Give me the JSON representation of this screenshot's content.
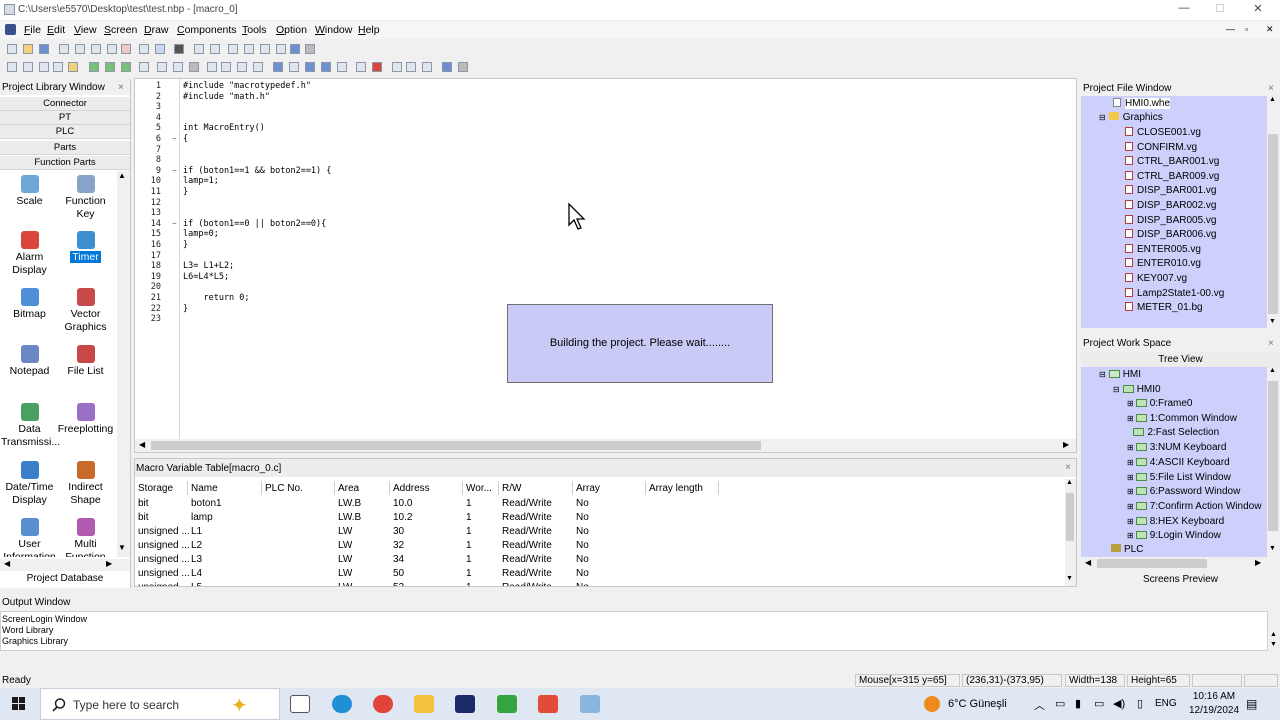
{
  "window": {
    "title": "C:\\Users\\e5570\\Desktop\\test\\test.nbp - [macro_0]",
    "minimize": "—",
    "maximize": "☐",
    "close": "✕"
  },
  "menu": [
    "File",
    "Edit",
    "View",
    "Screen",
    "Draw",
    "Components",
    "Tools",
    "Option",
    "Window",
    "Help"
  ],
  "library": {
    "title": "Project Library Window",
    "categories": [
      "Connector",
      "PT",
      "PLC",
      "Parts",
      "Function Parts"
    ],
    "items": [
      {
        "label": "Scale",
        "icon": "scale-icon",
        "color": "#6fa8d8"
      },
      {
        "label": "Function Key",
        "icon": "function-key-icon",
        "color": "#8aa3c8"
      },
      {
        "label": "Alarm Display",
        "icon": "alarm-display-icon",
        "color": "#d9473c"
      },
      {
        "label": "Timer",
        "icon": "timer-icon",
        "color": "#3f8fd0"
      },
      {
        "label": "Bitmap",
        "icon": "bitmap-icon",
        "color": "#4f8fd8"
      },
      {
        "label": "Vector Graphics",
        "icon": "vector-graphics-icon",
        "color": "#c84a4a"
      },
      {
        "label": "Notepad",
        "icon": "notepad-icon",
        "color": "#6b88c4"
      },
      {
        "label": "File List",
        "icon": "file-list-icon",
        "color": "#c84848"
      },
      {
        "label": "Data Transmissi...",
        "icon": "data-transmission-icon",
        "color": "#4aa060"
      },
      {
        "label": "Freeplotting",
        "icon": "freeplotting-icon",
        "color": "#9a6fc8"
      },
      {
        "label": "Date/Time Display",
        "icon": "date-time-icon",
        "color": "#3a7fc8"
      },
      {
        "label": "Indirect Shape",
        "icon": "indirect-shape-icon",
        "color": "#c86a2a"
      },
      {
        "label": "User Information",
        "icon": "user-icon",
        "color": "#5a8fcf"
      },
      {
        "label": "Multi Function",
        "icon": "multi-function-icon",
        "color": "#b05ab0"
      }
    ],
    "footer": "Project Database"
  },
  "editor": {
    "lines": [
      "#include \"macrotypedef.h\"",
      "#include \"math.h\"",
      "",
      "",
      "int MacroEntry()",
      "{",
      "",
      "",
      "if (boton1==1 && boton2==1) {",
      "lamp=1;",
      "}",
      "",
      "",
      "if (boton1==0 || boton2==0){",
      "lamp=0;",
      "}",
      "",
      "L3= L1+L2;",
      "L6=L4*L5;",
      "",
      "    return 0;",
      "}",
      ""
    ]
  },
  "dialog": {
    "message": "Building the project. Please wait........"
  },
  "macro_table": {
    "title": "Macro Variable Table[macro_0.c]",
    "columns": [
      "Storage ...",
      "Name",
      "PLC No.",
      "Area",
      "Address",
      "Wor...",
      "R/W",
      "Array",
      "Array length"
    ],
    "rows": [
      [
        "bit",
        "boton1",
        "",
        "LW.B",
        "10.0",
        "1",
        "Read/Write",
        "No",
        ""
      ],
      [
        "bit",
        "lamp",
        "",
        "LW.B",
        "10.2",
        "1",
        "Read/Write",
        "No",
        ""
      ],
      [
        "unsigned ...",
        "L1",
        "",
        "LW",
        "30",
        "1",
        "Read/Write",
        "No",
        ""
      ],
      [
        "unsigned ...",
        "L2",
        "",
        "LW",
        "32",
        "1",
        "Read/Write",
        "No",
        ""
      ],
      [
        "unsigned ...",
        "L3",
        "",
        "LW",
        "34",
        "1",
        "Read/Write",
        "No",
        ""
      ],
      [
        "unsigned ...",
        "L4",
        "",
        "LW",
        "50",
        "1",
        "Read/Write",
        "No",
        ""
      ],
      [
        "unsigned ...",
        "L5",
        "",
        "LW",
        "52",
        "1",
        "Read/Write",
        "No",
        ""
      ]
    ]
  },
  "project_files": {
    "title": "Project File Window",
    "root": "HMI0.whe",
    "folder": "Graphics",
    "files": [
      "CLOSE001.vg",
      "CONFIRM.vg",
      "CTRL_BAR001.vg",
      "CTRL_BAR009.vg",
      "DISP_BAR001.vg",
      "DISP_BAR002.vg",
      "DISP_BAR005.vg",
      "DISP_BAR006.vg",
      "ENTER005.vg",
      "ENTER010.vg",
      "KEY007.vg",
      "Lamp2State1-00.vg",
      "METER_01.bg"
    ]
  },
  "workspace": {
    "title": "Project Work Space",
    "tab": "Tree View",
    "hmi": "HMI",
    "hmi0": "HMI0",
    "windows": [
      "0:Frame0",
      "1:Common Window",
      "2:Fast Selection",
      "3:NUM Keyboard",
      "4:ASCII Keyboard",
      "5:File List Window",
      "6:Password Window",
      "7:Confirm Action Window",
      "8:HEX Keyboard",
      "9:Login Window"
    ],
    "plc": "PLC",
    "footer": "Screens Preview"
  },
  "output": {
    "title": "Output Window",
    "lines": [
      "ScreenLogin Window",
      "Word Library",
      "Graphics Library"
    ]
  },
  "status": {
    "ready": "Ready",
    "mouse": "Mouse[x=315  y=65]",
    "coords": "(236,31)-(373,95)",
    "width": "Width=138",
    "height": "Height=65"
  },
  "taskbar": {
    "search": "Type here to search",
    "weather": "6°C  Güneşli",
    "lang": "ENG",
    "time": "10:16 AM",
    "date": "12/19/2024"
  }
}
